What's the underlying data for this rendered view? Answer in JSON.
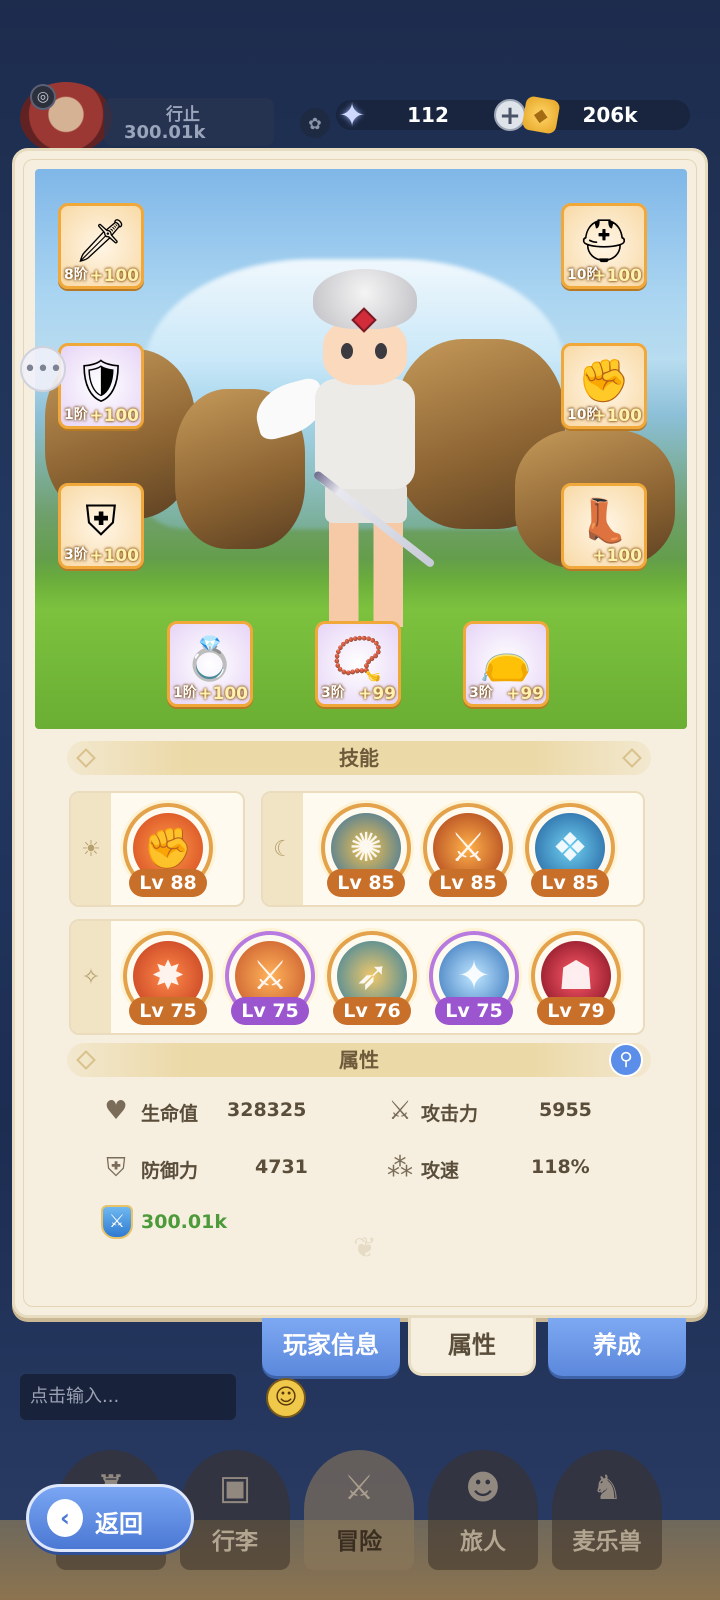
{
  "topbar": {
    "player_name": "行止",
    "player_power": "300.01k",
    "gems": "112",
    "gold": "206k",
    "gem_icon": "star-gem-icon",
    "gold_icon": "gold-coin-icon"
  },
  "equipment": {
    "left": [
      {
        "tier": "8阶",
        "plus": "+100",
        "icon": "sword-icon"
      },
      {
        "tier": "1阶",
        "plus": "+100",
        "icon": "armor-icon"
      },
      {
        "tier": "3阶",
        "plus": "+100",
        "icon": "belt-armor-icon"
      }
    ],
    "right": [
      {
        "tier": "10阶",
        "plus": "+100",
        "icon": "helmet-icon"
      },
      {
        "tier": "10阶",
        "plus": "+100",
        "icon": "gauntlet-icon"
      },
      {
        "tier": "",
        "plus": "+100",
        "icon": "boots-icon"
      }
    ],
    "bottom": [
      {
        "tier": "1阶",
        "plus": "+100",
        "icon": "ring-icon"
      },
      {
        "tier": "3阶",
        "plus": "+99",
        "icon": "necklace-icon"
      },
      {
        "tier": "3阶",
        "plus": "+99",
        "icon": "pouch-icon"
      }
    ]
  },
  "skills": {
    "title": "技能",
    "row1_left": [
      {
        "lv": "Lv 88"
      }
    ],
    "row1_right": [
      {
        "lv": "Lv 85"
      },
      {
        "lv": "Lv 85"
      },
      {
        "lv": "Lv 85"
      }
    ],
    "row2": [
      {
        "lv": "Lv 75"
      },
      {
        "lv": "Lv 75"
      },
      {
        "lv": "Lv 76"
      },
      {
        "lv": "Lv 75"
      },
      {
        "lv": "Lv 79"
      }
    ]
  },
  "attributes": {
    "title": "属性",
    "hp_label": "生命值",
    "hp_value": "328325",
    "atk_label": "攻击力",
    "atk_value": "5955",
    "def_label": "防御力",
    "def_value": "4731",
    "spd_label": "攻速",
    "spd_value": "118%",
    "power_value": "300.01k"
  },
  "tabs": {
    "player_info": "玩家信息",
    "attributes": "属性",
    "develop": "养成"
  },
  "chat": {
    "placeholder": "点击输入..."
  },
  "nav": {
    "items": [
      "行李",
      "冒险",
      "旅人",
      "麦乐兽"
    ],
    "back": "返回"
  },
  "colors": {
    "panel_bg": "#f6efdf",
    "tab_blue": "#6a96e6",
    "power_green": "#4d9a3a",
    "skill_orange": "#c8702a",
    "skill_purple": "#9a55cf"
  }
}
